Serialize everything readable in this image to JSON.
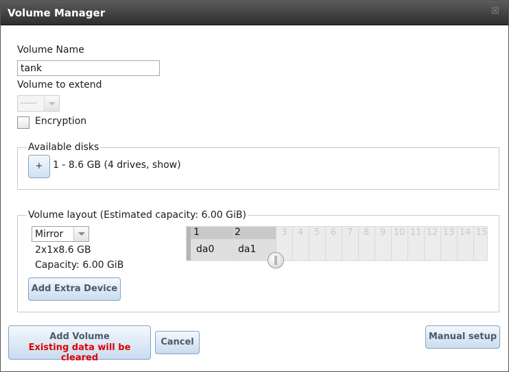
{
  "dialog": {
    "title": "Volume Manager",
    "close_icon": "close-icon"
  },
  "form": {
    "volume_name_label": "Volume Name",
    "volume_name_value": "tank",
    "volume_to_extend_label": "Volume to extend",
    "volume_to_extend_value": "-----",
    "encryption_label": "Encryption"
  },
  "available_disks": {
    "legend": "Available disks",
    "add_button": "+",
    "disk_group": "1 - 8.6 GB (4 drives, show)"
  },
  "layout": {
    "legend": "Volume layout (Estimated capacity: 6.00 GiB)",
    "layout_type": "Mirror",
    "config": "2x1x8.6 GB",
    "capacity": "Capacity: 6.00 GiB",
    "add_extra_device": "Add Extra Device",
    "columns": [
      "1",
      "2",
      "3",
      "4",
      "5",
      "6",
      "7",
      "8",
      "9",
      "10",
      "11",
      "12",
      "13",
      "14",
      "15"
    ],
    "disks": [
      "da0",
      "da1"
    ]
  },
  "footer": {
    "add_volume": "Add Volume",
    "warning": "Existing data will be cleared",
    "cancel": "Cancel",
    "manual_setup": "Manual setup"
  },
  "colors": {
    "warning": "#e00000",
    "titlebar": "#3a3a3a",
    "button_border": "#7ea3c8"
  }
}
